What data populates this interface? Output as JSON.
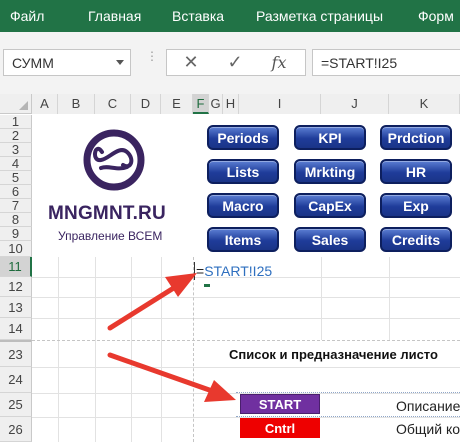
{
  "ribbon": {
    "tabs": [
      "Файл",
      "Главная",
      "Вставка",
      "Разметка страницы",
      "Форм"
    ]
  },
  "formula_bar": {
    "name_box": "СУММ",
    "cancel_symbol": "✕",
    "enter_symbol": "✓",
    "fx_label": "fx",
    "formula": "=START!I25"
  },
  "columns": [
    "A",
    "B",
    "C",
    "D",
    "E",
    "F",
    "G",
    "H",
    "I",
    "J",
    "K"
  ],
  "rows": [
    "1",
    "2",
    "3",
    "4",
    "5",
    "6",
    "7",
    "8",
    "9",
    "10",
    "11",
    "12",
    "13",
    "14",
    "23",
    "24",
    "25",
    "26"
  ],
  "logo": {
    "brand": "MNGMNT.RU",
    "tagline": "Управление ВСЕМ"
  },
  "nav_buttons": [
    "Periods",
    "KPI",
    "Prdction",
    "Lists",
    "Mrkting",
    "HR",
    "Macro",
    "CapEx",
    "Exp",
    "Items",
    "Sales",
    "Credits"
  ],
  "cell_f11": {
    "equals": "=",
    "reference": "START!I25"
  },
  "list_section": {
    "title": "Список и предназначение листо",
    "items": [
      {
        "button": "START",
        "color": "#7030a0",
        "description": "Описание"
      },
      {
        "button": "Cntrl",
        "color": "#ee0000",
        "description": "Общий ко"
      }
    ]
  },
  "colors": {
    "ribbon": "#217346",
    "brand": "#3a2460",
    "nav_button": "#1f3c9a",
    "arrow": "#e8392e",
    "formula_ref": "#2e6fbf"
  }
}
